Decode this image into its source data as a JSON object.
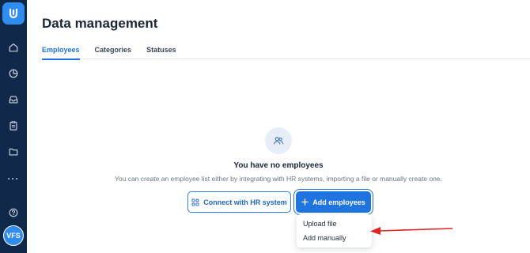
{
  "sidebar": {
    "items": [
      {
        "icon": "home-icon"
      },
      {
        "icon": "analytics-icon"
      },
      {
        "icon": "inbox-icon"
      },
      {
        "icon": "clipboard-icon"
      },
      {
        "icon": "folder-icon"
      },
      {
        "icon": "more-icon",
        "label": "···"
      },
      {
        "icon": "help-icon"
      }
    ],
    "avatar": "VFS"
  },
  "page": {
    "title": "Data management",
    "tabs": [
      {
        "label": "Employees",
        "active": true
      },
      {
        "label": "Categories",
        "active": false
      },
      {
        "label": "Statuses",
        "active": false
      }
    ]
  },
  "empty_state": {
    "icon": "users-icon",
    "title": "You have no employees",
    "description": "You can create an employee list either by integrating with HR systems, importing a file or manually create one."
  },
  "actions": {
    "connect_label": "Connect with HR system",
    "add_label": "Add employees",
    "add_menu": [
      "Upload file",
      "Add manually"
    ]
  },
  "colors": {
    "sidebar": "#10294a",
    "accent": "#1f74e0",
    "annotation_arrow": "#e02424"
  }
}
